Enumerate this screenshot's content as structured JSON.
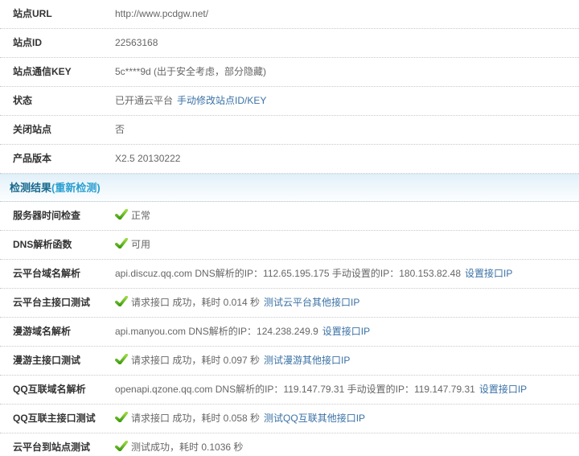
{
  "colors": {
    "link_blue": "#3a71a5",
    "label_text": "#333333",
    "value_text": "#666666",
    "section_title_blue": "#17698e",
    "section_action_blue": "#2a9fd0",
    "check_green_light": "#9ddb44",
    "check_green_dark": "#3f9c10",
    "divider_dotted": "#c9c9c9",
    "section_band_top": "#e2f0f9"
  },
  "info_rows": [
    {
      "label": "站点URL",
      "value": "http://www.pcdgw.net/"
    },
    {
      "label": "站点ID",
      "value": "22563168"
    },
    {
      "label": "站点通信KEY",
      "value": "5c****9d (出于安全考虑，部分隐藏)"
    },
    {
      "label": "状态",
      "value": "已开通云平台",
      "link": "手动修改站点ID/KEY"
    },
    {
      "label": "关闭站点",
      "value": "否"
    },
    {
      "label": "产品版本",
      "value": "X2.5 20130222"
    }
  ],
  "section": {
    "title": "检测结果",
    "action": "(重新检测)"
  },
  "check_rows": [
    {
      "label": "服务器时间检查",
      "value": "正常"
    },
    {
      "label": "DNS解析函数",
      "value": "可用"
    },
    {
      "label": "云平台域名解析",
      "value": "api.discuz.qq.com DNS解析的IP：112.65.195.175 手动设置的IP：180.153.82.48",
      "link": "设置接口IP"
    },
    {
      "label": "云平台主接口测试",
      "value": "请求接口 成功，耗时 0.014 秒",
      "link": "测试云平台其他接口IP"
    },
    {
      "label": "漫游域名解析",
      "value": "api.manyou.com DNS解析的IP：124.238.249.9",
      "link": "设置接口IP"
    },
    {
      "label": "漫游主接口测试",
      "value": "请求接口 成功，耗时 0.097 秒",
      "link": "测试漫游其他接口IP"
    },
    {
      "label": "QQ互联域名解析",
      "value": "openapi.qzone.qq.com DNS解析的IP：119.147.79.31 手动设置的IP：119.147.79.31",
      "link": "设置接口IP"
    },
    {
      "label": "QQ互联主接口测试",
      "value": "请求接口 成功，耗时 0.058 秒",
      "link": "测试QQ互联其他接口IP"
    },
    {
      "label": "云平台到站点测试",
      "value": "测试成功，耗时 0.1036 秒"
    }
  ]
}
